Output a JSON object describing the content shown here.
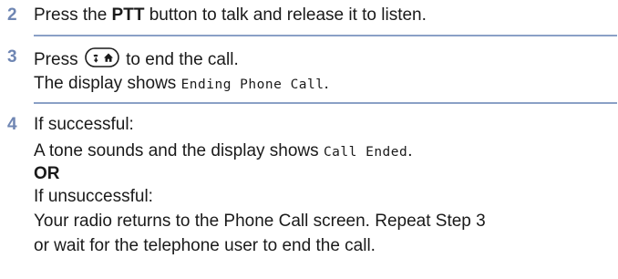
{
  "steps": [
    {
      "number": "2",
      "text_before": "Press the ",
      "button_name": "PTT",
      "text_after": " button to talk and release it to listen."
    },
    {
      "number": "3",
      "text_before": "Press",
      "text_after": "to end the call.",
      "key_icon": "end-call-home-key-icon",
      "display_prefix": "The display shows ",
      "display_text": "Ending Phone Call",
      "display_suffix": "."
    },
    {
      "number": "4",
      "success_label": "If successful:",
      "success_prefix": "A tone sounds and the display shows ",
      "success_display": "Call Ended",
      "success_suffix": ".",
      "or_label": "OR",
      "fail_label": "If unsuccessful:",
      "fail_line1": "Your radio returns to the Phone Call screen. Repeat Step 3",
      "fail_line2": "or wait for the telephone user to end the call."
    }
  ],
  "colors": {
    "step_number": "#6f86b3",
    "rule": "#8aa0c6",
    "text": "#1a1a1a"
  }
}
